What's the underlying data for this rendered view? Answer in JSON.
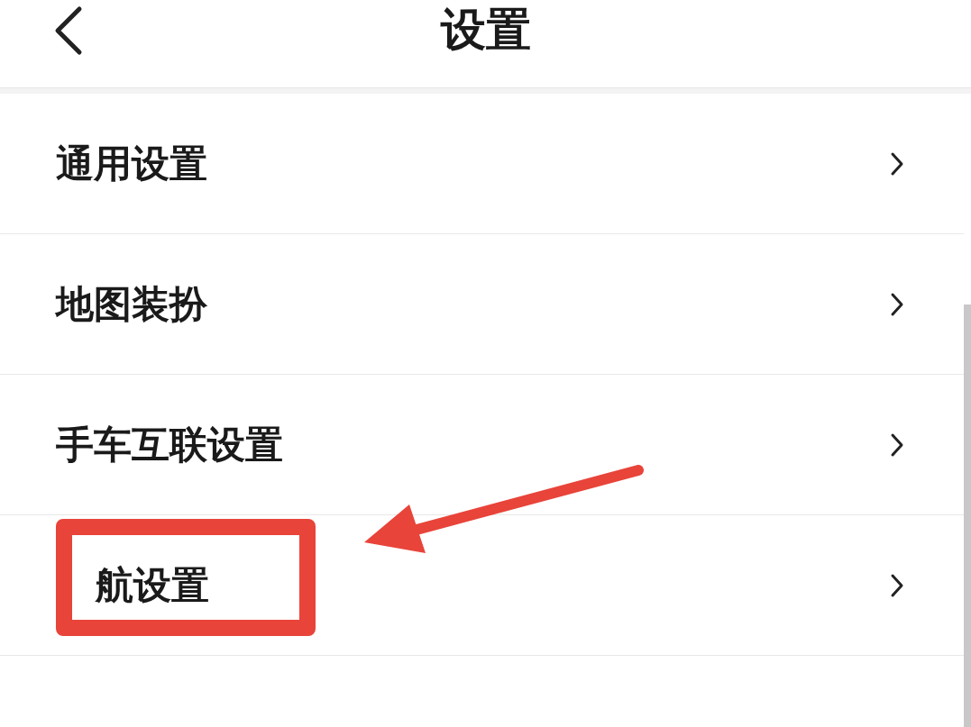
{
  "header": {
    "title": "设置"
  },
  "items": [
    {
      "label": "通用设置",
      "highlighted": false
    },
    {
      "label": "地图装扮",
      "highlighted": false
    },
    {
      "label": "手车互联设置",
      "highlighted": false
    },
    {
      "label": "航设置",
      "highlighted": true
    }
  ]
}
